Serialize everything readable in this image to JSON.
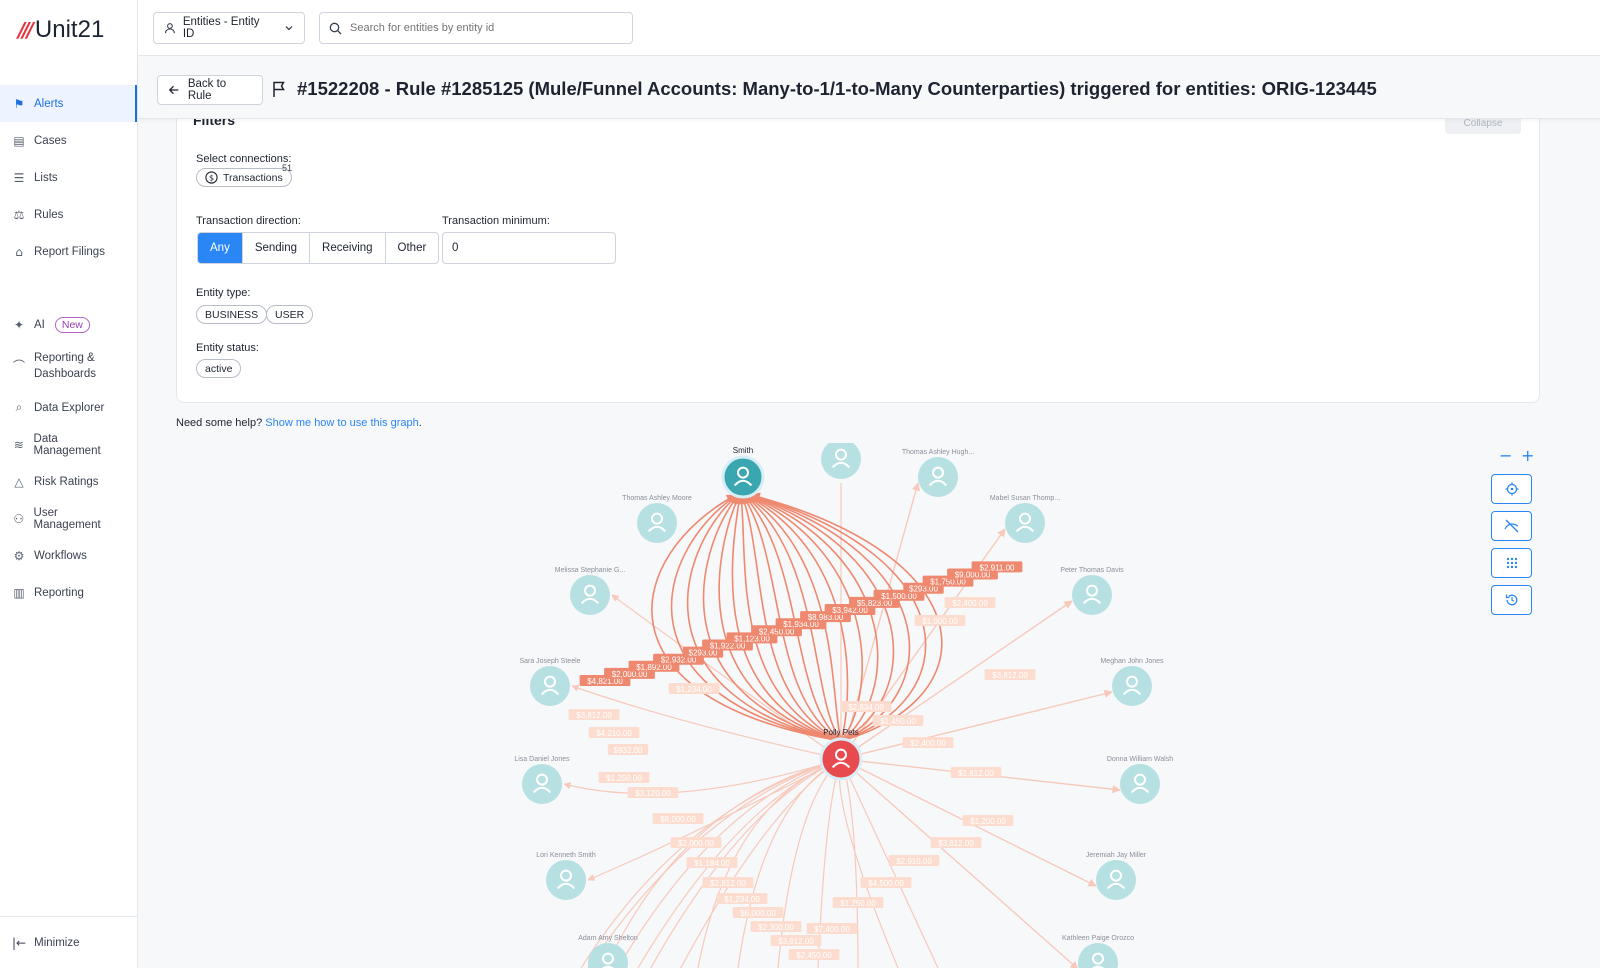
{
  "app": {
    "logo_text": "Unit21",
    "logo_mark": "///"
  },
  "sidebar": {
    "items": [
      {
        "label": "Alerts",
        "icon": "flag-icon"
      },
      {
        "label": "Cases",
        "icon": "briefcase-icon"
      },
      {
        "label": "Lists",
        "icon": "list-icon"
      },
      {
        "label": "Rules",
        "icon": "scale-icon"
      },
      {
        "label": "Report Filings",
        "icon": "bank-icon"
      },
      {
        "label": "AI",
        "icon": "sparkle-icon",
        "badge": "New"
      },
      {
        "label": "Reporting &",
        "label2": "Dashboards",
        "icon": "chart-icon"
      },
      {
        "label": "Data Explorer",
        "icon": "search-list-icon"
      },
      {
        "label": "Data Management",
        "icon": "database-icon"
      },
      {
        "label": "Risk Ratings",
        "icon": "warning-icon"
      },
      {
        "label": "User Management",
        "icon": "users-icon"
      },
      {
        "label": "Workflows",
        "icon": "gear-icon"
      },
      {
        "label": "Reporting",
        "icon": "report-icon"
      }
    ],
    "minimize": "Minimize"
  },
  "topbar": {
    "entity_select": "Entities - Entity ID",
    "search_placeholder": "Search for entities by entity id"
  },
  "header": {
    "back": "Back to Rule",
    "title": "#1522208 - Rule #1285125 (Mule/Funnel Accounts: Many-to-1/1-to-Many Counterparties) triggered for entities: ORIG-123445"
  },
  "filters": {
    "title": "Filters",
    "collapse_label": "Collapse",
    "select_connections": "Select connections:",
    "transactions_chip": "Transactions",
    "transactions_count": "51",
    "direction_label": "Transaction direction:",
    "directions": [
      "Any",
      "Sending",
      "Receiving",
      "Other"
    ],
    "minimum_label": "Transaction minimum:",
    "minimum_value": "0",
    "entity_type_label": "Entity type:",
    "entity_types": [
      "BUSINESS",
      "USER"
    ],
    "entity_status_label": "Entity status:",
    "entity_statuses": [
      "active"
    ]
  },
  "help": {
    "text": "Need some help? ",
    "link": "Show me how to use this graph",
    "end": "."
  },
  "graph": {
    "hub_smith": "Smith",
    "hub_polly": "Polly Pets",
    "nodes": [
      "",
      "Thomas Ashley Hugh...",
      "Thomas Ashley Moore",
      "Mabel Susan Thomp...",
      "Melissa Stephanie G...",
      "Peter Thomas Davis",
      "Sara Joseph Steele",
      "Meghan John Jones",
      "Lisa Daniel Jones",
      "Donna William Walsh",
      "Lori Kenneth Smith",
      "Jeremiah Jay Miller",
      "Adam Amy Shelton",
      "Kathleen Paige Orozco"
    ],
    "strong_labels": [
      "$4,821.00",
      "$2,000.00",
      "$1,892.00",
      "$2,932.00",
      "$293.00",
      "$1,922.00",
      "$1,123.00",
      "$2,450.00",
      "$1,934.00",
      "$8,983.00",
      "$3,942.00",
      "$5,823.00",
      "$1,500.00",
      "$293.00",
      "$1,750.00",
      "$9,000.00",
      "$2,911.00"
    ],
    "faint_labels": [
      "$3,812.00",
      "$4,210.00",
      "$932.00",
      "$1,250.00",
      "$3,120.00",
      "$8,000.00",
      "$2,000.00",
      "$1,184.00",
      "$2,812.00",
      "$1,234.00",
      "$6,000.00",
      "$2,300.00",
      "$3,812.00",
      "$2,450.00",
      "$7,400.00",
      "$1,250.00",
      "$4,500.00",
      "$2,910.00",
      "$3,812.00",
      "$1,812.00",
      "$1,200.00",
      "$3,812.00",
      "$2,400.00",
      "$1,000.00",
      "$2,400.00",
      "$1,450.00",
      "$2,834.00",
      "$1,234.00"
    ]
  },
  "tools": {
    "zoom_out": "−",
    "zoom_in": "+"
  },
  "colors": {
    "accent": "#2a86f5",
    "edge": "#ee8970",
    "node": "#b7e0e3",
    "smith": "#3aa6b0",
    "polly": "#e84b4f"
  }
}
